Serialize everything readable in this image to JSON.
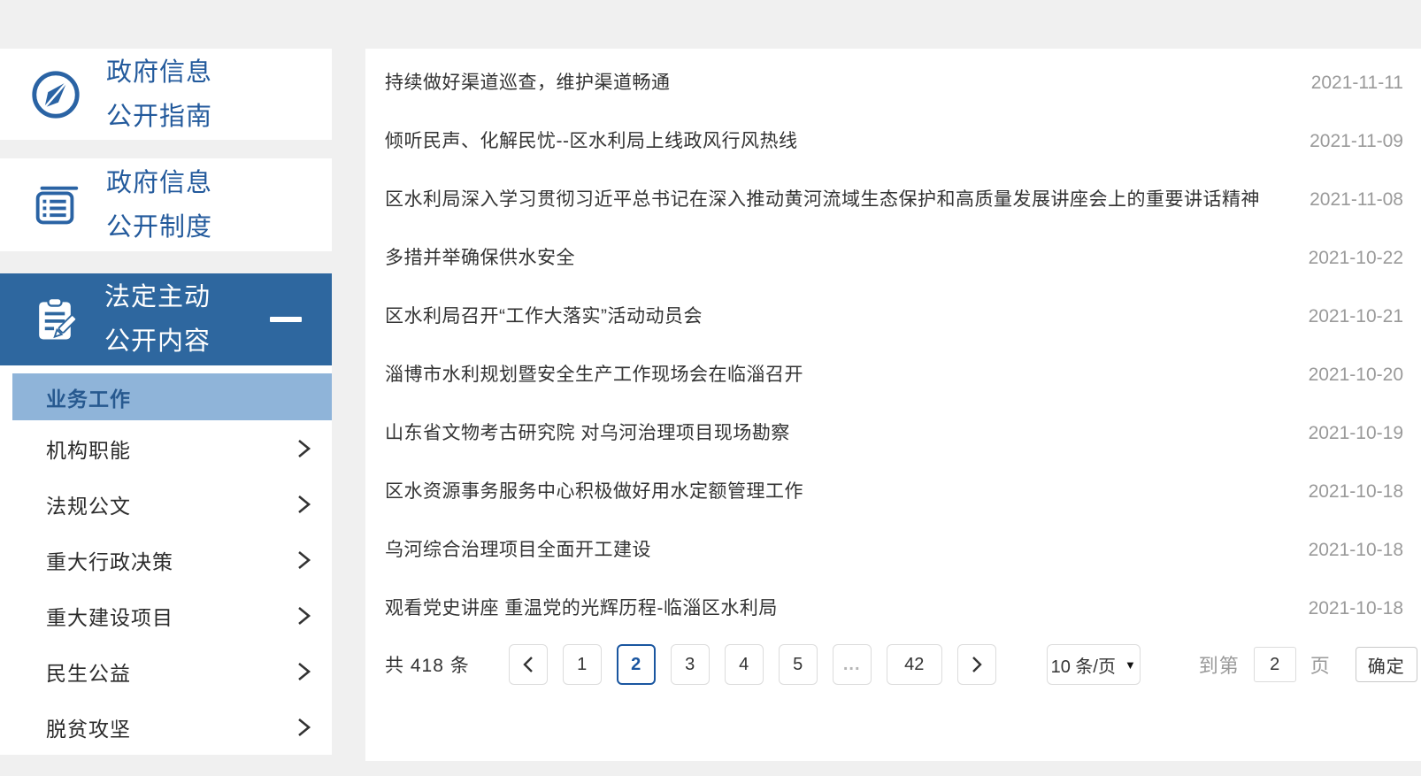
{
  "colors": {
    "page_background": "#f0f0f0",
    "panel_background": "#ffffff",
    "sidebar_blue": "#235a9c",
    "active_tile_background": "#2e679f",
    "active_subitem_background": "#8fb4d9",
    "active_subitem_text": "#27598f",
    "news_title_text": "#333333",
    "news_date_text": "#9a9a9a",
    "pagination_active_blue": "#1a56a0",
    "pagination_border": "#dcdcdc"
  },
  "sidebar": {
    "top_items": [
      {
        "icon": "compass-icon",
        "line1": "政府信息",
        "line2": "公开指南",
        "active": false
      },
      {
        "icon": "notebook-icon",
        "line1": "政府信息",
        "line2": "公开制度",
        "active": false
      },
      {
        "icon": "clipboard-pencil-icon",
        "line1": "法定主动",
        "line2": "公开内容",
        "active": true,
        "collapse_indicator": "minus-icon"
      }
    ],
    "submenu": {
      "active_item": "业务工作",
      "items": [
        {
          "label": "机构职能"
        },
        {
          "label": "法规公文"
        },
        {
          "label": "重大行政决策"
        },
        {
          "label": "重大建设项目"
        },
        {
          "label": "民生公益"
        },
        {
          "label": "脱贫攻坚"
        }
      ]
    }
  },
  "news": {
    "items": [
      {
        "title": "持续做好渠道巡查，维护渠道畅通",
        "date": "2021-11-11"
      },
      {
        "title": "倾听民声、化解民忧--区水利局上线政风行风热线",
        "date": "2021-11-09"
      },
      {
        "title": "区水利局深入学习贯彻习近平总书记在深入推动黄河流域生态保护和高质量发展讲座会上的重要讲话精神",
        "date": "2021-11-08"
      },
      {
        "title": "多措并举确保供水安全",
        "date": "2021-10-22"
      },
      {
        "title": "区水利局召开“工作大落实”活动动员会",
        "date": "2021-10-21"
      },
      {
        "title": "淄博市水利规划暨安全生产工作现场会在临淄召开",
        "date": "2021-10-20"
      },
      {
        "title": "山东省文物考古研究院 对乌河治理项目现场勘察",
        "date": "2021-10-19"
      },
      {
        "title": "区水资源事务服务中心积极做好用水定额管理工作",
        "date": "2021-10-18"
      },
      {
        "title": "乌河综合治理项目全面开工建设",
        "date": "2021-10-18"
      },
      {
        "title": "观看党史讲座 重温党的光辉历程-临淄区水利局",
        "date": "2021-10-18"
      }
    ]
  },
  "pagination": {
    "total_label": "共 418 条",
    "pages": [
      "1",
      "2",
      "3",
      "4",
      "5",
      "...",
      "42"
    ],
    "active_page": "2",
    "page_size_label": "10 条/页",
    "jump_prefix": "到第",
    "jump_value": "2",
    "jump_suffix": "页",
    "confirm_label": "确定"
  }
}
